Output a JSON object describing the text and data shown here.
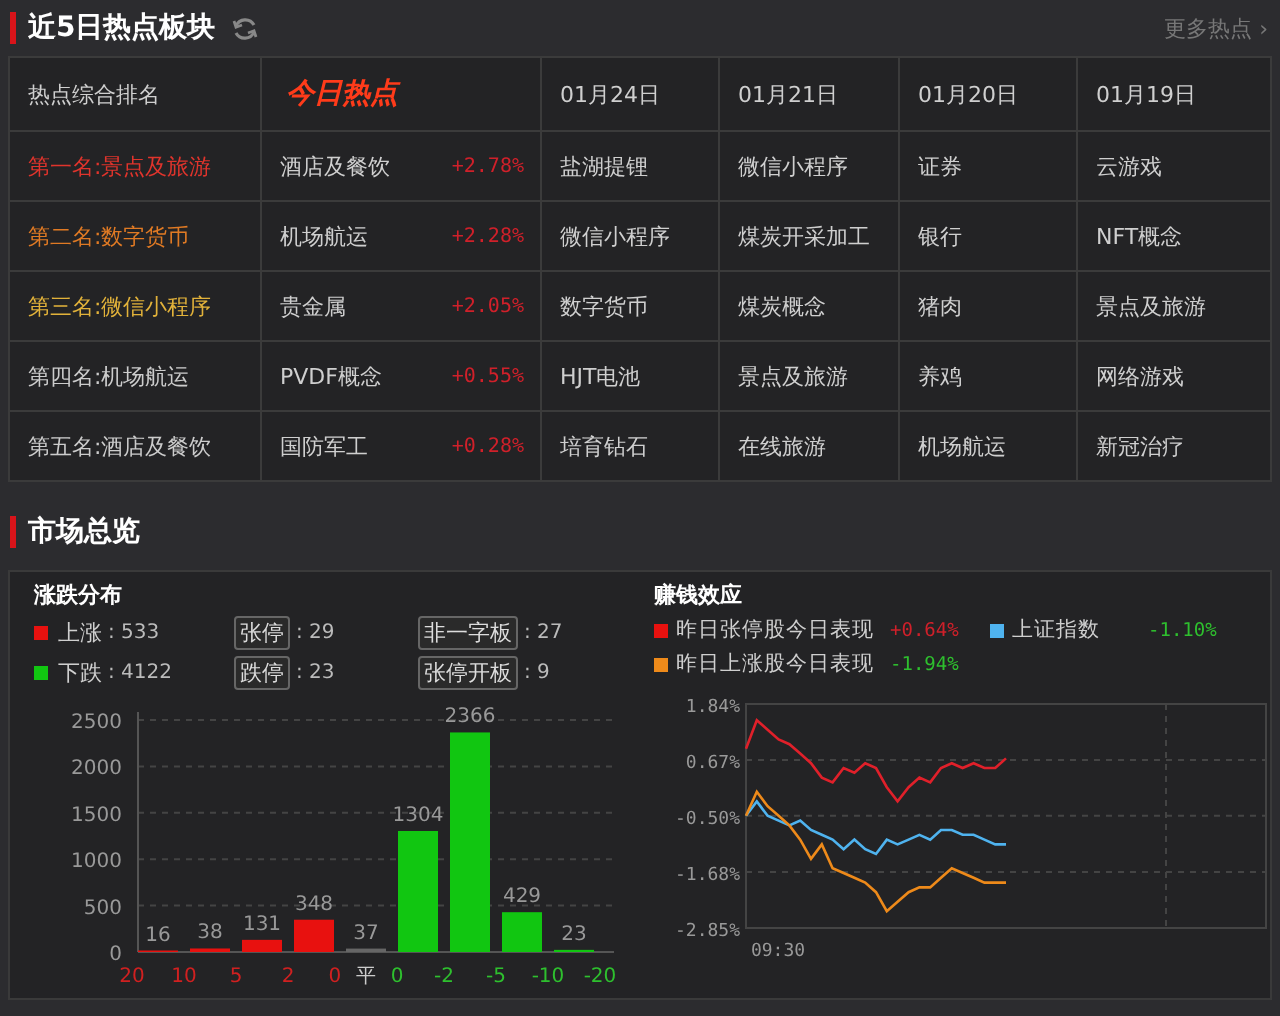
{
  "hot_sectors": {
    "title": "近5日热点板块",
    "more_link": "更多热点 ›",
    "table": {
      "columns": [
        "热点综合排名",
        "今日热点",
        "01月24日",
        "01月21日",
        "01月20日",
        "01月19日"
      ],
      "rows": [
        {
          "rank": "第一名:景点及旅游",
          "color": "#e0342c",
          "today": "酒店及餐饮",
          "change": "+2.78%",
          "days": [
            "盐湖提锂",
            "微信小程序",
            "证券",
            "云游戏"
          ]
        },
        {
          "rank": "第二名:数字货币",
          "color": "#e07a24",
          "today": "机场航运",
          "change": "+2.28%",
          "days": [
            "微信小程序",
            "煤炭开采加工",
            "银行",
            "NFT概念"
          ]
        },
        {
          "rank": "第三名:微信小程序",
          "color": "#e2b23a",
          "today": "贵金属",
          "change": "+2.05%",
          "days": [
            "数字货币",
            "煤炭概念",
            "猪肉",
            "景点及旅游"
          ]
        },
        {
          "rank": "第四名:机场航运",
          "color": "#cccccc",
          "today": "PVDF概念",
          "change": "+0.55%",
          "days": [
            "HJT电池",
            "景点及旅游",
            "养鸡",
            "网络游戏"
          ]
        },
        {
          "rank": "第五名:酒店及餐饮",
          "color": "#cccccc",
          "today": "国防军工",
          "change": "+0.28%",
          "days": [
            "培育钻石",
            "在线旅游",
            "机场航运",
            "新冠治疗"
          ]
        }
      ]
    }
  },
  "market_overview": {
    "title": "市场总览",
    "distribution": {
      "title": "涨跌分布",
      "legend": [
        {
          "label": "上涨",
          "value": ": 533",
          "color": "#e8110f"
        },
        {
          "label": "下跌",
          "value": ": 4122",
          "color": "#11c611"
        }
      ],
      "stats": [
        {
          "label": "张停",
          "value": ": 29"
        },
        {
          "label": "非一字板",
          "value": ": 27"
        },
        {
          "label": "跌停",
          "value": ": 23"
        },
        {
          "label": "张停开板",
          "value": ": 9"
        }
      ],
      "x_axis_labels": [
        {
          "text": "20",
          "color": "#d02020"
        },
        {
          "text": "10",
          "color": "#d02020"
        },
        {
          "text": "5",
          "color": "#d02020"
        },
        {
          "text": "2",
          "color": "#d02020"
        },
        {
          "text": "0",
          "color": "#d02020"
        },
        {
          "text": "平",
          "color": "#cccccc"
        },
        {
          "text": "0",
          "color": "#2ec02e"
        },
        {
          "text": "-2",
          "color": "#2ec02e"
        },
        {
          "text": "-5",
          "color": "#2ec02e"
        },
        {
          "text": "-10",
          "color": "#2ec02e"
        },
        {
          "text": "-20",
          "color": "#2ec02e"
        }
      ],
      "chart_data": {
        "type": "bar",
        "ylim": [
          0,
          2500
        ],
        "yticks": [
          0,
          500,
          1000,
          1500,
          2000,
          2500
        ],
        "data_labels": true,
        "grid": true,
        "series": [
          {
            "color": "#e8110f",
            "values": [
              16,
              38,
              131,
              348,
              null,
              null,
              null,
              null,
              null
            ]
          },
          {
            "color": "#666666",
            "values": [
              null,
              null,
              null,
              null,
              37,
              null,
              null,
              null,
              null
            ]
          },
          {
            "color": "#11c611",
            "values": [
              null,
              null,
              null,
              null,
              null,
              1304,
              2366,
              429,
              23
            ]
          }
        ]
      }
    },
    "money_effect": {
      "title": "赚钱效应",
      "legend": [
        {
          "label": "昨日张停股今日表现",
          "value": {
            "text": "+0.64%",
            "color": "#d0202a"
          },
          "color": "#e8110f"
        },
        {
          "label": "上证指数",
          "value": {
            "text": "-1.10%",
            "color": "#2ec02e"
          },
          "color": "#4fb3ef"
        },
        {
          "label": "昨日上涨股今日表现",
          "value": {
            "text": "-1.94%",
            "color": "#2ec02e"
          },
          "color": "#ee8a1a"
        }
      ],
      "x_axis_labels": [
        "09:30"
      ],
      "chart_data": {
        "type": "line",
        "ylim": [
          -2.85,
          1.84
        ],
        "grid": true,
        "yticks": [
          {
            "value": 1.84,
            "label": "1.84%"
          },
          {
            "value": 0.67,
            "label": "0.67%"
          },
          {
            "value": -0.5,
            "label": "-0.50%"
          },
          {
            "value": -1.68,
            "label": "-1.68%"
          },
          {
            "value": -2.85,
            "label": "-2.85%"
          }
        ],
        "series": [
          {
            "color": "#e0202a",
            "values": [
              0.9,
              1.5,
              1.3,
              1.1,
              1.0,
              0.8,
              0.6,
              0.3,
              0.2,
              0.5,
              0.4,
              0.6,
              0.5,
              0.1,
              -0.2,
              0.1,
              0.3,
              0.2,
              0.5,
              0.6,
              0.5,
              0.6,
              0.5,
              0.5,
              0.7,
              null,
              null,
              null,
              null,
              null,
              null,
              null,
              null,
              null,
              null,
              null,
              null,
              null,
              null,
              null,
              null,
              null,
              null,
              null,
              null,
              null,
              null,
              null,
              null
            ]
          },
          {
            "color": "#4fb3ef",
            "values": [
              -0.5,
              -0.2,
              -0.5,
              -0.6,
              -0.7,
              -0.6,
              -0.8,
              -0.9,
              -1.0,
              -1.2,
              -1.0,
              -1.2,
              -1.3,
              -1.0,
              -1.1,
              -1.0,
              -0.9,
              -1.0,
              -0.8,
              -0.8,
              -0.9,
              -0.9,
              -1.0,
              -1.1,
              -1.1,
              null,
              null,
              null,
              null,
              null,
              null,
              null,
              null,
              null,
              null,
              null,
              null,
              null,
              null,
              null,
              null,
              null,
              null,
              null,
              null,
              null,
              null,
              null,
              null
            ]
          },
          {
            "color": "#ee8a1a",
            "values": [
              -0.5,
              0.0,
              -0.3,
              -0.5,
              -0.7,
              -1.0,
              -1.4,
              -1.1,
              -1.6,
              -1.7,
              -1.8,
              -1.9,
              -2.1,
              -2.5,
              -2.3,
              -2.1,
              -2.0,
              -2.0,
              -1.8,
              -1.6,
              -1.7,
              -1.8,
              -1.9,
              -1.9,
              -1.9,
              null,
              null,
              null,
              null,
              null,
              null,
              null,
              null,
              null,
              null,
              null,
              null,
              null,
              null,
              null,
              null,
              null,
              null,
              null,
              null,
              null,
              null,
              null,
              null
            ]
          }
        ]
      }
    }
  }
}
